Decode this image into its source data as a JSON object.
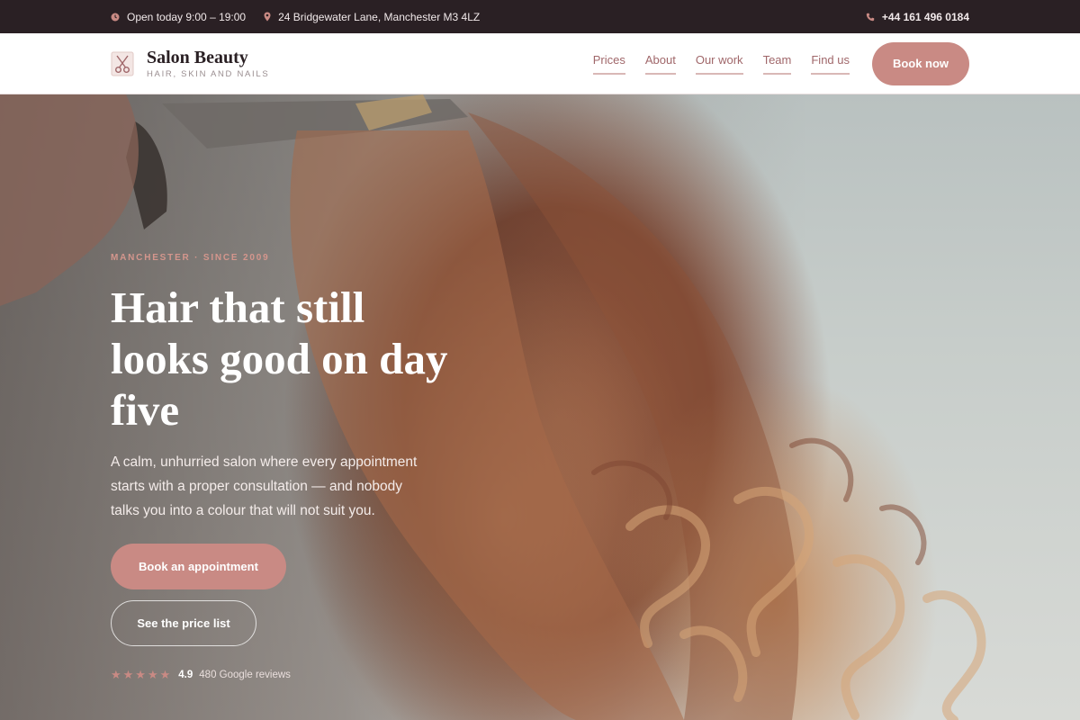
{
  "topbar": {
    "hours": "Open today 9:00 – 19:00",
    "address": "24 Bridgewater Lane, Manchester M3 4LZ",
    "phone": "+44 161 496 0184"
  },
  "header": {
    "brand_name": "Salon Beauty",
    "brand_tagline": "HAIR, SKIN AND NAILS",
    "nav": [
      {
        "label": "Prices"
      },
      {
        "label": "About"
      },
      {
        "label": "Our work"
      },
      {
        "label": "Team"
      },
      {
        "label": "Find us"
      }
    ],
    "cta_label": "Book now"
  },
  "hero": {
    "eyebrow": "MANCHESTER · SINCE 2009",
    "headline": "Hair that still looks good on day five",
    "intro": "A calm, unhurried salon where every appointment starts with a proper consultation — and nobody talks you into a colour that will not suit you.",
    "primary_button": "Book an appointment",
    "secondary_button": "See the price list",
    "rating": {
      "stars": "★★★★★",
      "score": "4.9",
      "reviews": "480 Google reviews"
    }
  },
  "icons": {
    "hours": "clock-icon",
    "address": "location-pin-icon",
    "phone": "phone-icon",
    "logo": "scissors-icon"
  },
  "colors": {
    "accent": "#c98a84",
    "accent_text": "#a0676a",
    "topbar_bg": "#2a2024"
  }
}
